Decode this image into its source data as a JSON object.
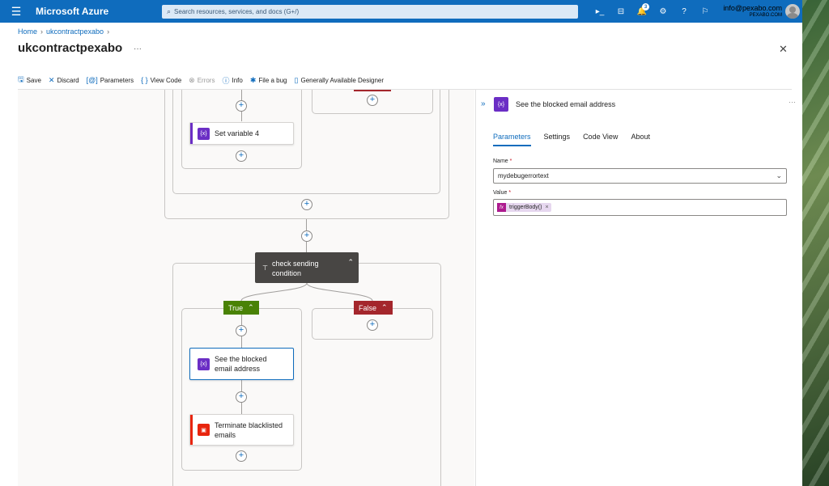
{
  "topbar": {
    "brand": "Microsoft Azure",
    "search_placeholder": "Search resources, services, and docs (G+/)",
    "notifications_count": "3",
    "account_email": "info@pexabo.com",
    "account_org": "PEXABO.COM"
  },
  "breadcrumb": {
    "home": "Home",
    "resource": "ukcontractpexabo"
  },
  "page": {
    "title": "ukcontractpexabo",
    "more": "···"
  },
  "toolbar": {
    "save": "Save",
    "discard": "Discard",
    "parameters": "Parameters",
    "view_code": "View Code",
    "errors": "Errors",
    "info": "Info",
    "file_bug": "File a bug",
    "designer": "Generally Available Designer"
  },
  "canvas": {
    "set_variable": "Set variable 4",
    "condition_line1": "check sending",
    "condition_line2": "condition",
    "true_label": "True",
    "false_label": "False",
    "see_blocked_line1": "See the blocked",
    "see_blocked_line2": "email address",
    "terminate_line1": "Terminate blacklisted",
    "terminate_line2": "emails",
    "variable_icon": "{x}"
  },
  "panel": {
    "title": "See the blocked email address",
    "tabs": [
      "Parameters",
      "Settings",
      "Code View",
      "About"
    ],
    "name_label": "Name",
    "name_value": "mydebugerrortext",
    "value_label": "Value",
    "token_label": "triggerBody()",
    "token_fx": "fx",
    "more": "···"
  },
  "colors": {
    "azure_blue": "#0f6cbd",
    "variable_purple": "#6b2ec5",
    "terminate_red": "#e8250e",
    "true_green": "#498205",
    "false_red": "#a4262c",
    "condition_dark": "#484644"
  }
}
